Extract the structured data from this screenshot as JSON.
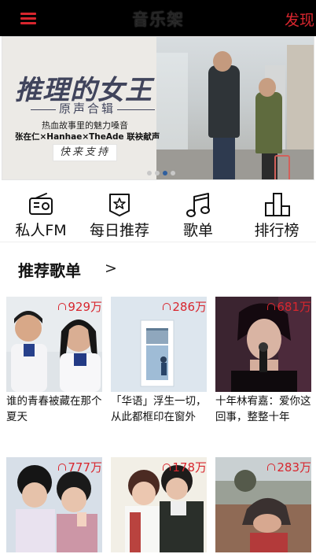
{
  "header": {
    "title": "音乐架",
    "discover_label": "发现",
    "menu_icon": "hamburger-menu-icon",
    "accent_color": "#d8262e"
  },
  "banner": {
    "title": "推理的女王",
    "subtitle": "原声合辑",
    "description": "热血故事里的魅力嗓音",
    "artists": "张在仁×Hanhae×TheAde 联袂献声",
    "button_label": "快来支持",
    "slide_count": 4,
    "active_slide": 3
  },
  "shortcuts": [
    {
      "label": "私人FM",
      "icon": "radio-icon"
    },
    {
      "label": "每日推荐",
      "icon": "calendar-star-icon"
    },
    {
      "label": "歌单",
      "icon": "music-note-icon"
    },
    {
      "label": "排行榜",
      "icon": "bar-chart-icon"
    }
  ],
  "recommend": {
    "title": "推荐歌单",
    "more_label": ">"
  },
  "playlists": [
    {
      "plays": "929万",
      "title": "谁的青春被藏在那个夏天"
    },
    {
      "plays": "286万",
      "title": "「华语」浮生一切，从此都框印在窗外"
    },
    {
      "plays": "681万",
      "title": "十年林宥嘉：爱你这回事，整整十年"
    },
    {
      "plays": "777万",
      "title": ""
    },
    {
      "plays": "178万",
      "title": ""
    },
    {
      "plays": "283万",
      "title": ""
    }
  ]
}
